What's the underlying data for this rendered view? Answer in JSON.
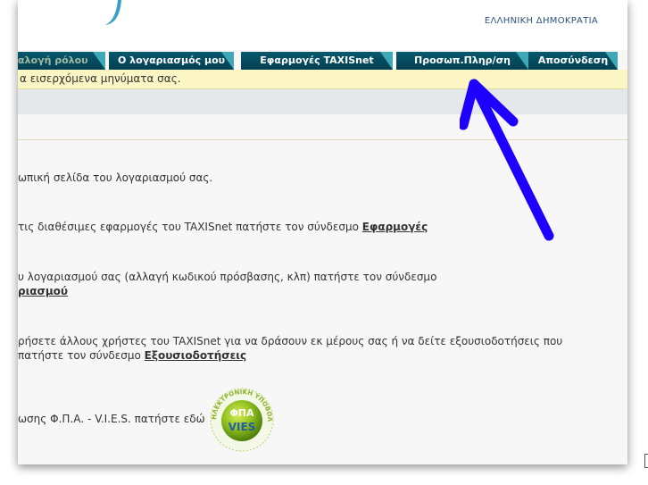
{
  "header": {
    "gov_label": "ΕΛΛΗΝΙΚΗ ΔΗΜΟΚΡΑΤΙΑ"
  },
  "tabs": [
    {
      "label": "αλογή ρόλου"
    },
    {
      "label": "Ο λογαριασμός μου"
    },
    {
      "label": "Εφαρμογές TAXISnet"
    },
    {
      "label": "Προσωπ.Πληρ/ση"
    },
    {
      "label": "Αποσύνδεση"
    }
  ],
  "notice": {
    "text": "α εισερχόμενα μηνύματα σας."
  },
  "content": {
    "p1": "ωπική σελίδα του λογαριασμού σας.",
    "p2": "τις διαθέσιμες εφαρμογές του TAXISnet πατήστε τον σύνδεσμο",
    "p2_link": "Εφαρμογές",
    "p3": "υ λογαριασμού σας (αλλαγή κωδικού πρόσβασης, κλπ) πατήστε τον σύνδεσμο",
    "p3_link": "ριασμού",
    "p4": "ρήσετε άλλους χρήστες του TAXISnet για να δράσουν εκ μέρους σας ή να δείτε εξουσιοδοτήσεις που",
    "p4_b": "πατήστε τον σύνδεσμο",
    "p4_link": "Εξουσιοδοτήσεις",
    "p5": "ωσης Φ.Π.Α. - V.I.E.S. πατήστε εδώ"
  },
  "badge": {
    "ring_text": "ΗΛΕΚΤΡΟΝΙΚΗ ΥΠΟΒΟΛΗ",
    "line1": "ΦΠΑ",
    "line2": "VIES"
  },
  "colors": {
    "tab_bg": "#034a5d",
    "tab_accent": "#3fa7b6",
    "notice_bg": "#fbf6c3",
    "arrow": "#1d00ff"
  }
}
